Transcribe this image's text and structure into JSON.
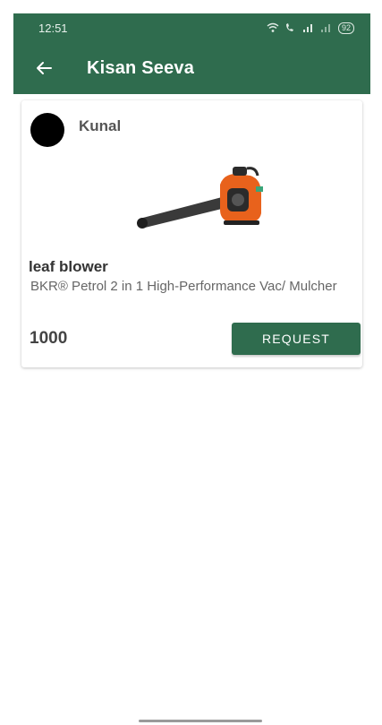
{
  "status_bar": {
    "time": "12:51",
    "battery": "92"
  },
  "app_bar": {
    "title": "Kisan Seeva",
    "back_icon": "arrow-left-icon"
  },
  "card": {
    "owner_name": "Kunal",
    "product_name": "leaf blower",
    "product_description": "BKR® Petrol 2 in 1 High-Performance Vac/ Mulcher",
    "price": "1000",
    "request_label": "REQUEST"
  },
  "colors": {
    "primary": "#2f6c4e",
    "product_orange": "#e8621c"
  }
}
